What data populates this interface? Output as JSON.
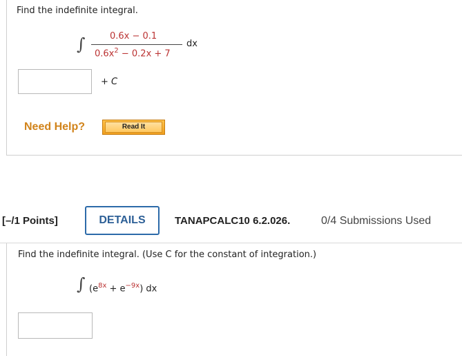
{
  "question1": {
    "prompt": "Find the indefinite integral.",
    "integral_sign": "∫",
    "numerator": "0.6x − 0.1",
    "denominator_a": "0.6x",
    "denominator_exp": "2",
    "denominator_b": " − 0.2x + 7",
    "dx": "dx",
    "answer_value": "",
    "plus": "+ ",
    "constant": "C",
    "need_help": "Need Help?",
    "read_it": "Read It"
  },
  "question2": {
    "points": "[–/1 Points]",
    "details": "DETAILS",
    "code": "TANAPCALC10 6.2.026.",
    "submissions": "0/4 Submissions Used",
    "prompt": "Find the indefinite integral. (Use C for the constant of integration.)",
    "integral_sign": "∫",
    "open_paren": "(e",
    "exp1": "8x",
    "plus_e": " + e",
    "exp2": "−9x",
    "close_paren": ")",
    "dx": "dx",
    "answer_value": ""
  },
  "colors": {
    "accent_orange": "#d1831a",
    "details_blue": "#2c6aa9",
    "math_red": "#b33333"
  }
}
